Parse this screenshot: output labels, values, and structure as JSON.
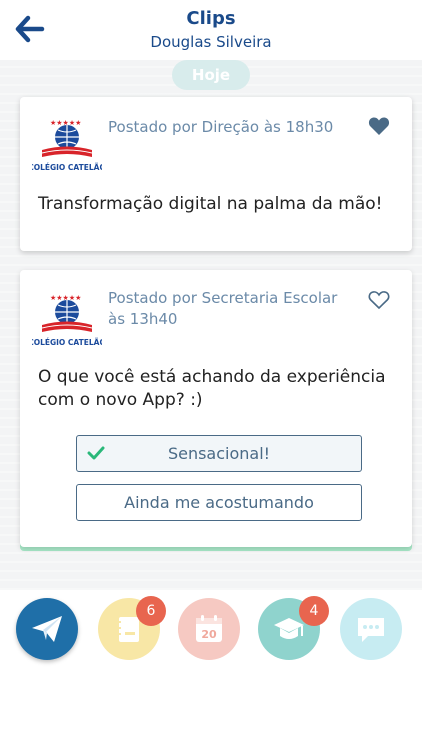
{
  "header": {
    "title": "Clips",
    "subtitle": "Douglas Silveira"
  },
  "feed": {
    "date_label": "Hoje",
    "posts": [
      {
        "logo_text": "COLÉGIO CATELÃO",
        "meta": "Postado por Direção às 18h30",
        "liked": true,
        "text": "Transformação digital na palma da mão!"
      },
      {
        "logo_text": "COLÉGIO CATELÃO",
        "meta": "Postado por Secretaria Escolar às 13h40",
        "liked": false,
        "text": "O que você está achando da experiência com o novo App? :)",
        "options": [
          {
            "label": "Sensacional!",
            "selected": true
          },
          {
            "label": "Ainda me acostumando",
            "selected": false
          }
        ]
      }
    ]
  },
  "bottom_nav": {
    "items": [
      {
        "icon": "send-icon",
        "color": "#1f6fa8"
      },
      {
        "icon": "notebook-icon",
        "color": "#f8e7a6",
        "badge": "6"
      },
      {
        "icon": "calendar-icon",
        "color": "#f6c9c2",
        "calendar_day": "20"
      },
      {
        "icon": "graduation-cap-icon",
        "color": "#8fd3cd",
        "badge": "4"
      },
      {
        "icon": "chat-icon",
        "color": "#c7ecf2"
      }
    ]
  },
  "colors": {
    "primary": "#1a4a8a",
    "meta_text": "#6b8aa8",
    "badge": "#e8654f",
    "check": "#2ab87a"
  }
}
